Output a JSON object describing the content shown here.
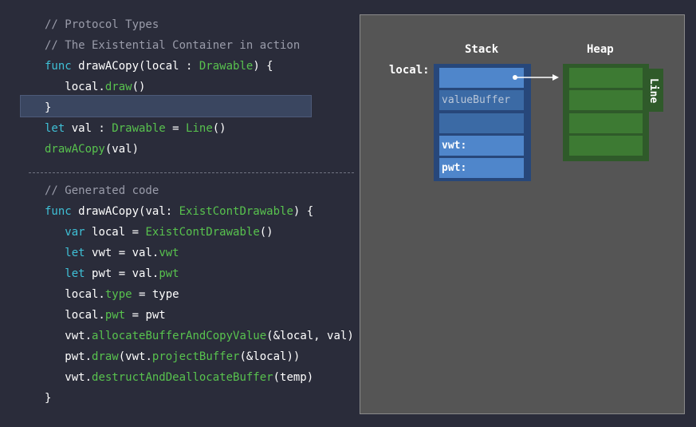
{
  "code": {
    "top": [
      {
        "tokens": [
          {
            "t": "// Protocol Types",
            "c": "comment"
          }
        ]
      },
      {
        "tokens": [
          {
            "t": "// The Existential Container in action",
            "c": "comment"
          }
        ]
      },
      {
        "tokens": [
          {
            "t": "func ",
            "c": "kw"
          },
          {
            "t": "drawACopy(local : ",
            "c": "plain"
          },
          {
            "t": "Drawable",
            "c": "type"
          },
          {
            "t": ") {",
            "c": "plain"
          }
        ]
      },
      {
        "tokens": [
          {
            "t": "   local.",
            "c": "plain"
          },
          {
            "t": "draw",
            "c": "fn"
          },
          {
            "t": "()",
            "c": "plain"
          }
        ]
      },
      {
        "tokens": [
          {
            "t": "}",
            "c": "plain"
          }
        ]
      },
      {
        "tokens": [
          {
            "t": "let ",
            "c": "kw"
          },
          {
            "t": "val : ",
            "c": "plain"
          },
          {
            "t": "Drawable",
            "c": "type"
          },
          {
            "t": " = ",
            "c": "plain"
          },
          {
            "t": "Line",
            "c": "type"
          },
          {
            "t": "()",
            "c": "plain"
          }
        ]
      },
      {
        "tokens": [
          {
            "t": "drawACopy",
            "c": "fn"
          },
          {
            "t": "(val)",
            "c": "plain"
          }
        ]
      }
    ],
    "bottom": [
      {
        "tokens": [
          {
            "t": "// Generated code",
            "c": "comment"
          }
        ]
      },
      {
        "tokens": [
          {
            "t": "func ",
            "c": "kw"
          },
          {
            "t": "drawACopy(val: ",
            "c": "plain"
          },
          {
            "t": "ExistContDrawable",
            "c": "type"
          },
          {
            "t": ") {",
            "c": "plain"
          }
        ]
      },
      {
        "tokens": [
          {
            "t": "   var ",
            "c": "kw"
          },
          {
            "t": "local = ",
            "c": "plain"
          },
          {
            "t": "ExistContDrawable",
            "c": "type"
          },
          {
            "t": "()",
            "c": "plain"
          }
        ]
      },
      {
        "tokens": [
          {
            "t": "   let ",
            "c": "kw"
          },
          {
            "t": "vwt = val.",
            "c": "plain"
          },
          {
            "t": "vwt",
            "c": "fn"
          }
        ]
      },
      {
        "tokens": [
          {
            "t": "   let ",
            "c": "kw"
          },
          {
            "t": "pwt = val.",
            "c": "plain"
          },
          {
            "t": "pwt",
            "c": "fn"
          }
        ]
      },
      {
        "tokens": [
          {
            "t": "   local.",
            "c": "plain"
          },
          {
            "t": "type",
            "c": "fn"
          },
          {
            "t": " = type",
            "c": "plain"
          }
        ]
      },
      {
        "tokens": [
          {
            "t": "   local.",
            "c": "plain"
          },
          {
            "t": "pwt",
            "c": "fn"
          },
          {
            "t": " = pwt",
            "c": "plain"
          }
        ]
      },
      {
        "tokens": [
          {
            "t": "   vwt.",
            "c": "plain"
          },
          {
            "t": "allocateBufferAndCopyValue",
            "c": "fn"
          },
          {
            "t": "(&local, val)",
            "c": "plain"
          }
        ]
      },
      {
        "tokens": [
          {
            "t": "   pwt.",
            "c": "plain"
          },
          {
            "t": "draw",
            "c": "fn"
          },
          {
            "t": "(vwt.",
            "c": "plain"
          },
          {
            "t": "projectBuffer",
            "c": "fn"
          },
          {
            "t": "(&local))",
            "c": "plain"
          }
        ]
      },
      {
        "tokens": [
          {
            "t": "   vwt.",
            "c": "plain"
          },
          {
            "t": "destructAndDeallocateBuffer",
            "c": "fn"
          },
          {
            "t": "(temp)",
            "c": "plain"
          }
        ]
      },
      {
        "tokens": [
          {
            "t": "}",
            "c": "plain"
          }
        ]
      }
    ]
  },
  "diagram": {
    "stack_title": "Stack",
    "heap_title": "Heap",
    "local_label": "local:",
    "value_buffer_label": "valueBuffer",
    "vwt_label": "vwt:",
    "pwt_label": "pwt:",
    "heap_object_label": "Line"
  }
}
